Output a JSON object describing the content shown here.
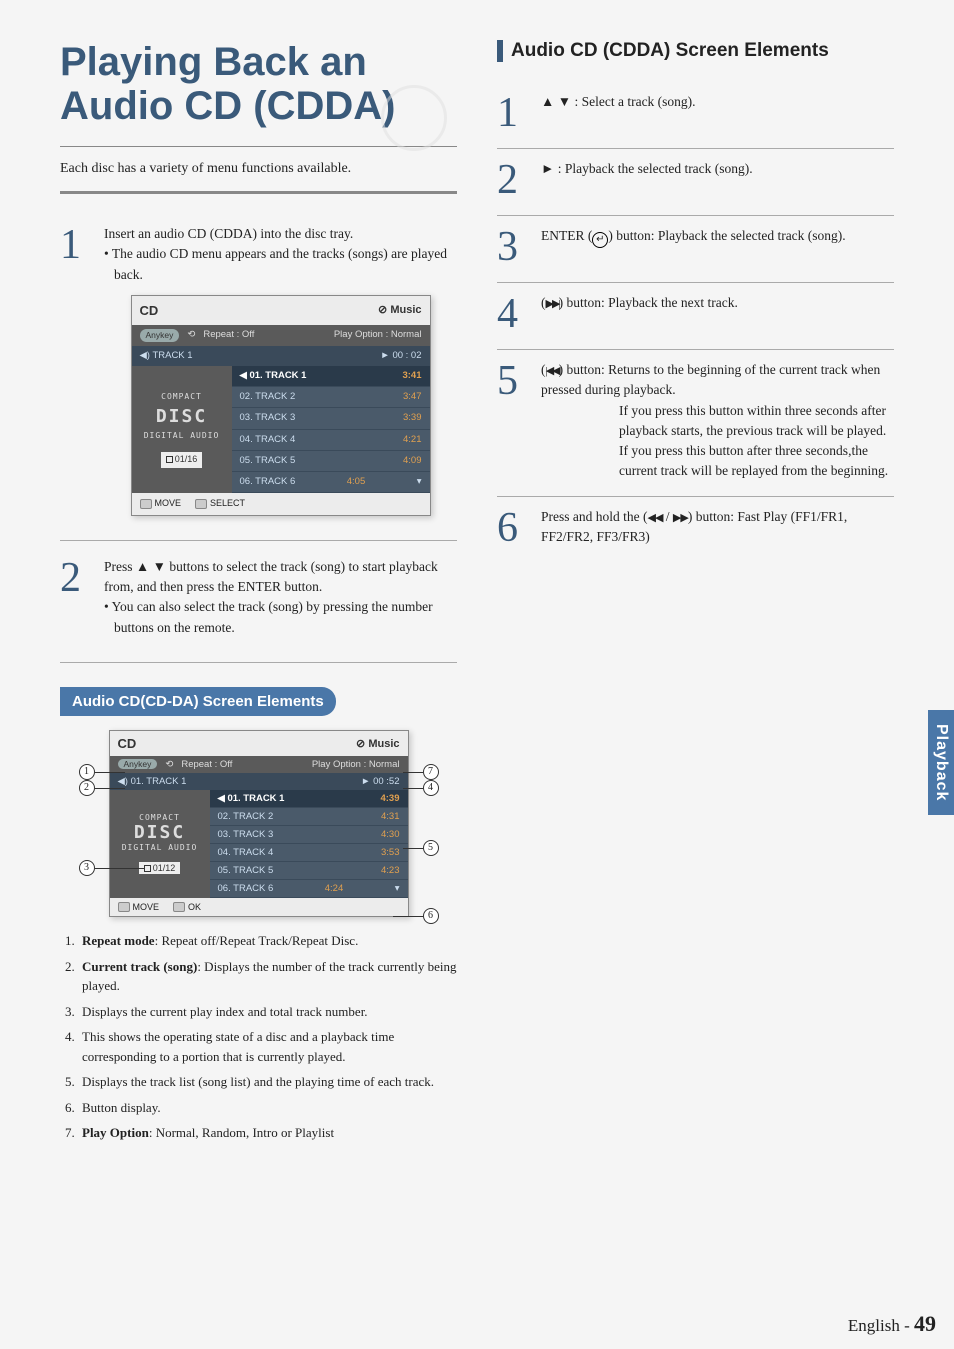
{
  "heading": "Playing Back an Audio CD (CDDA)",
  "intro": "Each disc has a variety of menu functions available.",
  "left_steps": {
    "s1": {
      "main": "Insert an audio CD (CDDA) into the disc tray.",
      "sub": "• The audio CD menu appears and the tracks (songs) are played back."
    },
    "s2": {
      "main": "Press ▲ ▼ buttons to select the track (song) to start playback from, and then press the ENTER button.",
      "sub": "• You can also select the track (song) by pressing the number buttons on the remote."
    }
  },
  "panel1": {
    "title": "CD",
    "music": "Music",
    "anyk": "Anykey",
    "repeat": "Repeat : Off",
    "playopt": "Play Option : Normal",
    "track_label": "TRACK 1",
    "time": "00 : 02",
    "logo1": "COMPACT",
    "logo2": "DISC",
    "logo3": "DIGITAL AUDIO",
    "counter": "01/16",
    "tracks": [
      {
        "n": "01. TRACK 1",
        "t": "3:41"
      },
      {
        "n": "02. TRACK 2",
        "t": "3:47"
      },
      {
        "n": "03. TRACK 3",
        "t": "3:39"
      },
      {
        "n": "04. TRACK 4",
        "t": "4:21"
      },
      {
        "n": "05. TRACK 5",
        "t": "4:09"
      },
      {
        "n": "06. TRACK 6",
        "t": "4:05"
      }
    ],
    "move": "MOVE",
    "select": "SELECT"
  },
  "blue_heading": "Audio CD(CD-DA) Screen Elements",
  "panel2": {
    "title": "CD",
    "music": "Music",
    "anyk": "Anykey",
    "repeat": "Repeat : Off",
    "playopt": "Play Option : Normal",
    "track_label": "01. TRACK 1",
    "time": "00 :52",
    "logo1": "COMPACT",
    "logo2": "DISC",
    "logo3": "DIGITAL AUDIO",
    "counter": "01/12",
    "tracks": [
      {
        "n": "01. TRACK 1",
        "t": "4:39"
      },
      {
        "n": "02. TRACK 2",
        "t": "4:31"
      },
      {
        "n": "03. TRACK 3",
        "t": "4:30"
      },
      {
        "n": "04. TRACK 4",
        "t": "3:53"
      },
      {
        "n": "05. TRACK 5",
        "t": "4:23"
      },
      {
        "n": "06. TRACK 6",
        "t": "4:24"
      }
    ],
    "move": "MOVE",
    "ok": "OK"
  },
  "legend": [
    {
      "b": "Repeat mode",
      "t": ": Repeat off/Repeat Track/Repeat Disc."
    },
    {
      "b": "Current track (song)",
      "t": ": Displays the number of the track currently being played."
    },
    {
      "b": "",
      "t": "Displays the current play index and total track number."
    },
    {
      "b": "",
      "t": "This shows the operating state of a disc and a playback time corresponding to a portion that is currently played."
    },
    {
      "b": "",
      "t": "Displays the track list (song list) and the playing time of each track."
    },
    {
      "b": "",
      "t": "Button display."
    },
    {
      "b": "Play Option",
      "t": ": Normal, Random, Intro or Playlist"
    }
  ],
  "right_heading": "Audio CD (CDDA) Screen Elements",
  "right_steps": {
    "r1": "▲ ▼ : Select a track (song).",
    "r2": "► : Playback the selected track (song).",
    "r3_a": "ENTER (",
    "r3_b": ") button: Playback the selected track (song).",
    "r4_a": "(",
    "r4_b": ") button: Playback the next track.",
    "r5_a": "(",
    "r5_b": ") button: Returns to the beginning of the current track when pressed during playback.",
    "r5_c": "If you press this button within three seconds after playback starts, the previous track will be played. If you press this button after three seconds,the current track will be replayed from the beginning.",
    "r6_a": "Press and hold the (",
    "r6_b": " / ",
    "r6_c": ") button: Fast Play (FF1/FR1, FF2/FR2, FF3/FR3)"
  },
  "side_tab": "Playback",
  "footer_lang": "English - ",
  "footer_page": "49"
}
